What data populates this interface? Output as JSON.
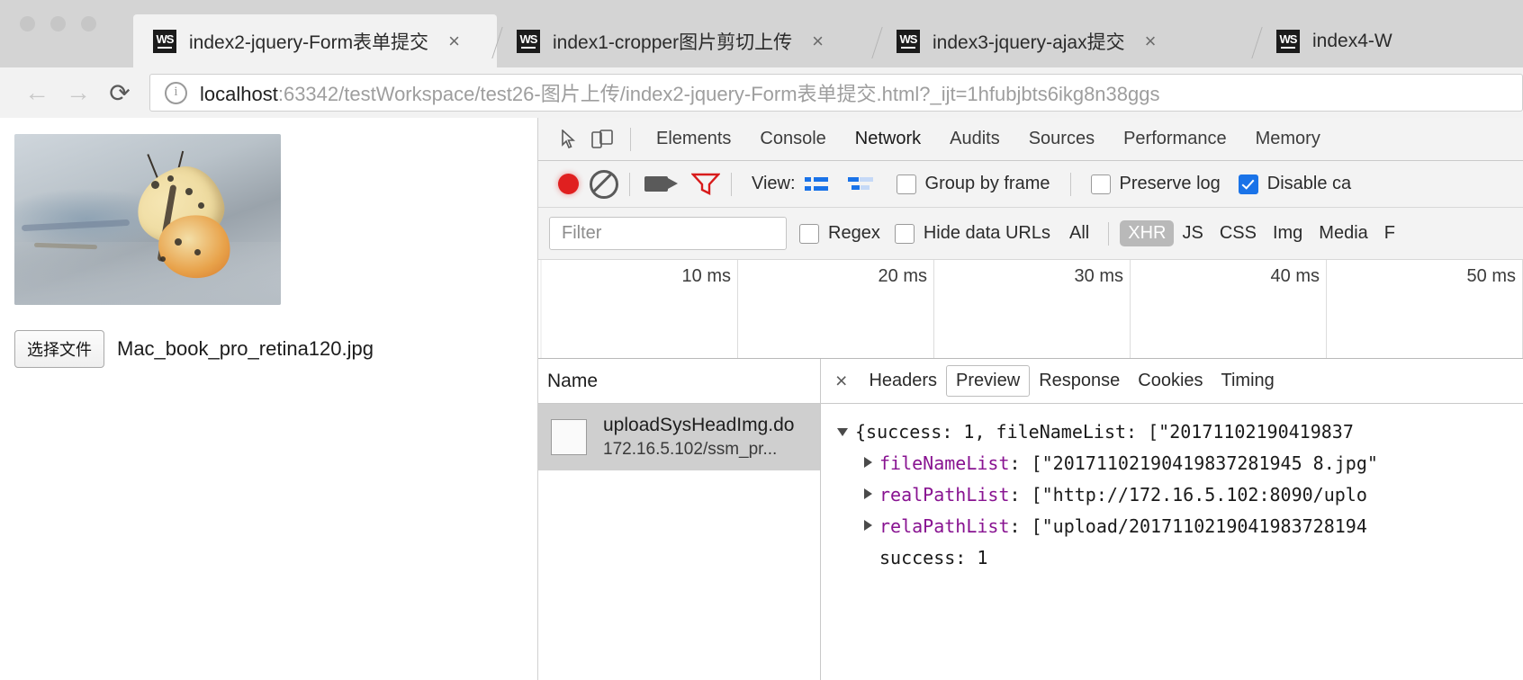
{
  "window": {
    "traffic_lights": [
      "close",
      "minimize",
      "zoom"
    ]
  },
  "tabs": [
    {
      "favicon": "ws-icon",
      "title": "index2-jquery-Form表单提交",
      "close": "×",
      "active": true
    },
    {
      "favicon": "ws-icon",
      "title": "index1-cropper图片剪切上传",
      "close": "×",
      "active": false
    },
    {
      "favicon": "ws-icon",
      "title": "index3-jquery-ajax提交",
      "close": "×",
      "active": false
    },
    {
      "favicon": "ws-icon",
      "title": "index4-W",
      "close": "×",
      "active": false
    }
  ],
  "toolbar": {
    "back": "←",
    "forward": "→",
    "reload": "⟳",
    "site_info": "ⓘ",
    "url_host": "localhost",
    "url_rest": ":63342/testWorkspace/test26-图片上传/index2-jquery-Form表单提交.html?_ijt=1hfubjbts6ikg8n38ggs"
  },
  "page": {
    "image_alt": "butterfly-photo",
    "file_button": "选择文件",
    "file_name": "Mac_book_pro_retina120.jpg"
  },
  "devtools": {
    "inspect_icon": "inspect-cursor-icon",
    "device_icon": "device-toolbar-icon",
    "tabs": [
      {
        "label": "Elements",
        "active": false
      },
      {
        "label": "Console",
        "active": false
      },
      {
        "label": "Network",
        "active": true
      },
      {
        "label": "Audits",
        "active": false
      },
      {
        "label": "Sources",
        "active": false
      },
      {
        "label": "Performance",
        "active": false
      },
      {
        "label": "Memory",
        "active": false
      }
    ],
    "network_toolbar": {
      "record_icon": "record-button-icon",
      "clear_icon": "clear-icon",
      "capture_screenshots_icon": "camera-icon",
      "filter_icon": "funnel-icon",
      "view_label": "View:",
      "view_list_icon": "list-view-icon",
      "view_waterfall_icon": "waterfall-view-icon",
      "group_by_frame": {
        "label": "Group by frame",
        "checked": false
      },
      "preserve_log": {
        "label": "Preserve log",
        "checked": false
      },
      "disable_cache": {
        "label": "Disable ca",
        "checked": true
      }
    },
    "filter_bar": {
      "filter_placeholder": "Filter",
      "regex": {
        "label": "Regex",
        "checked": false
      },
      "hide_data_urls": {
        "label": "Hide data URLs",
        "checked": false
      },
      "types": [
        {
          "label": "All",
          "selected": false
        },
        {
          "label": "XHR",
          "selected": true
        },
        {
          "label": "JS",
          "selected": false
        },
        {
          "label": "CSS",
          "selected": false
        },
        {
          "label": "Img",
          "selected": false
        },
        {
          "label": "Media",
          "selected": false
        },
        {
          "label": "F",
          "selected": false
        }
      ]
    },
    "timeline_ticks": [
      "10 ms",
      "20 ms",
      "30 ms",
      "40 ms",
      "50 ms"
    ],
    "requests_header": "Name",
    "requests": [
      {
        "name": "uploadSysHeadImg.do",
        "domain": "172.16.5.102/ssm_pr...",
        "selected": true
      }
    ],
    "detail_tabs": [
      {
        "label": "Headers",
        "active": false
      },
      {
        "label": "Preview",
        "active": true
      },
      {
        "label": "Response",
        "active": false
      },
      {
        "label": "Cookies",
        "active": false
      },
      {
        "label": "Timing",
        "active": false
      }
    ],
    "detail_close": "×",
    "preview": {
      "root_line": "{success: 1, fileNameList: [\"20171102190419837",
      "rows": [
        {
          "key": "fileNameList",
          "value": "[\"20171102190419837281945 8.jpg\"",
          "expandable": true
        },
        {
          "key": "realPathList",
          "value": "[\"http://172.16.5.102:8090/uplo",
          "expandable": true
        },
        {
          "key": "relaPathList",
          "value": "[\"upload/2017110219041983728194",
          "expandable": true
        },
        {
          "key": "success",
          "value": "1",
          "expandable": false
        }
      ]
    }
  },
  "colors": {
    "accent_blue": "#1a73e8",
    "record_red": "#e02020",
    "key_purple": "#881391",
    "selection_gray": "#cfcfcf",
    "chrome_gray": "#d4d4d4"
  }
}
